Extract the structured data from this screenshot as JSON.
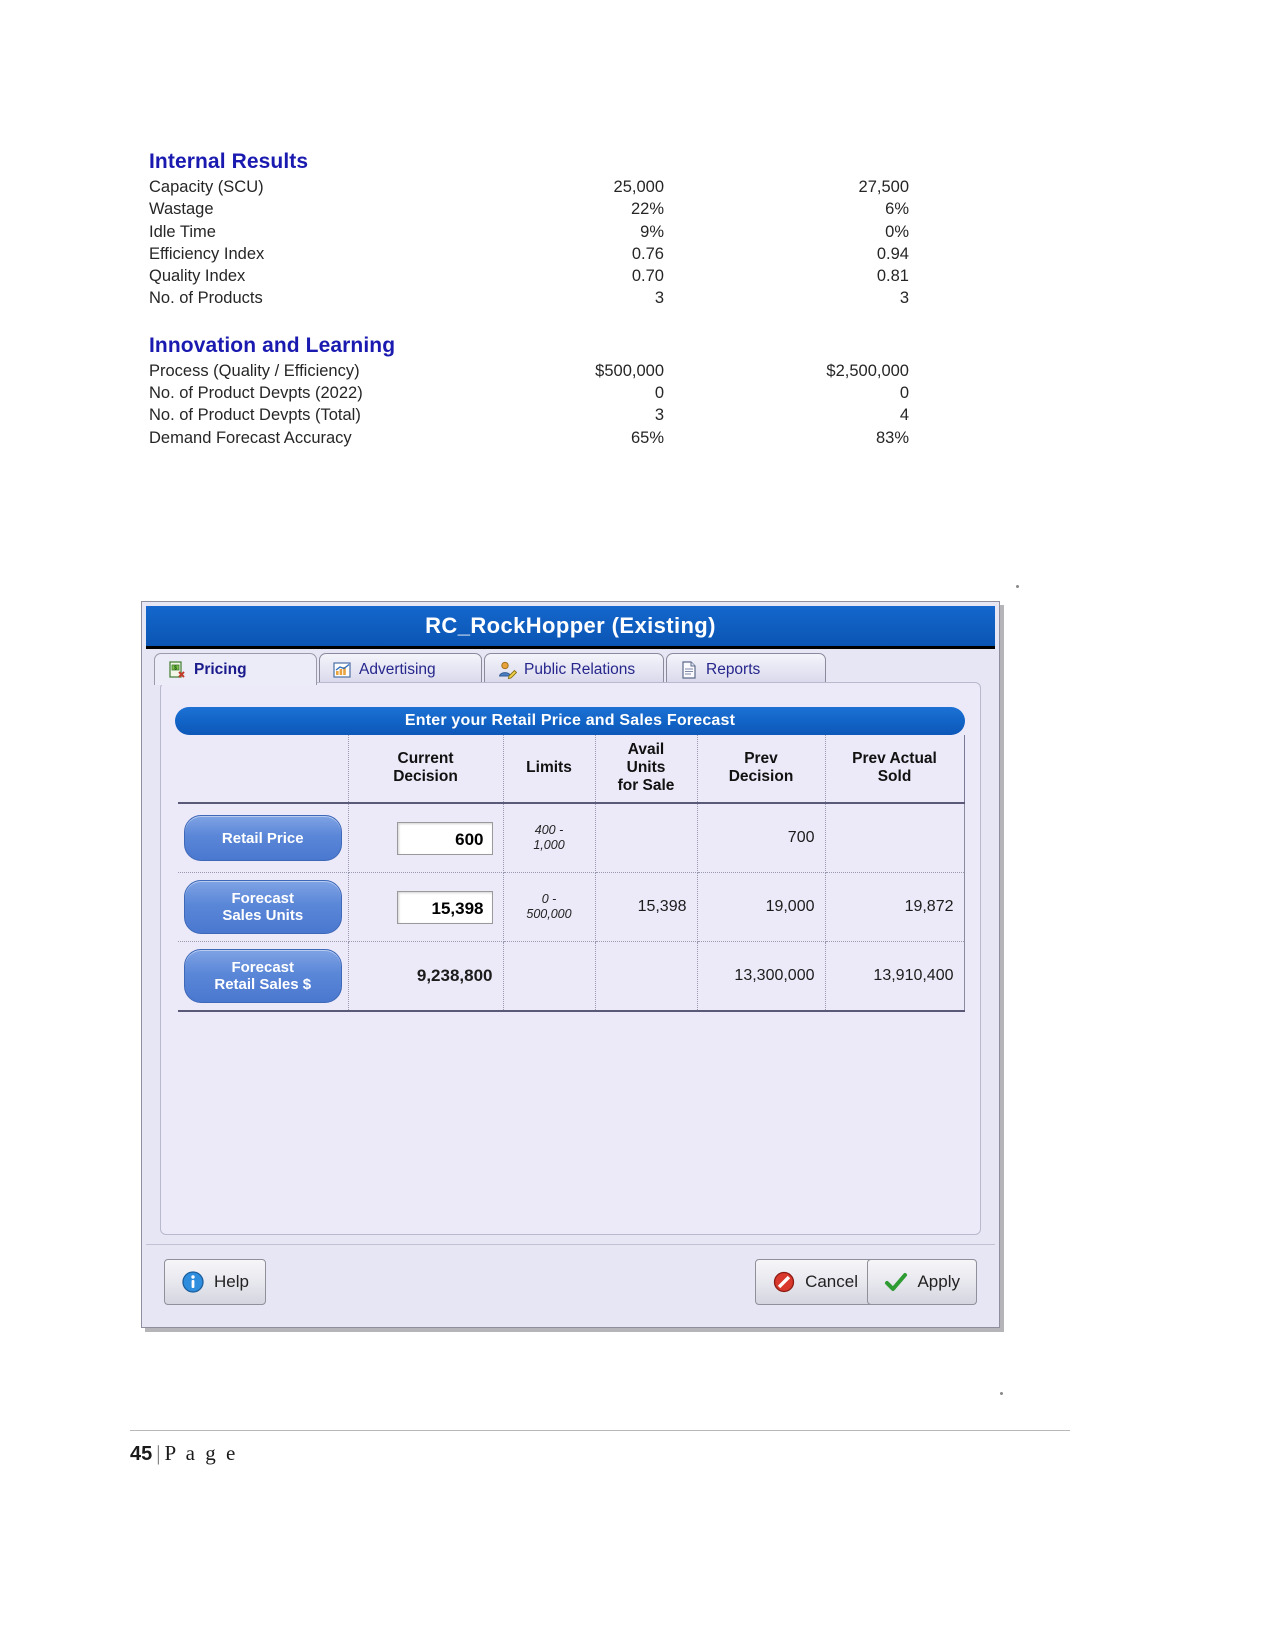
{
  "report": {
    "sections": [
      {
        "title": "Internal Results",
        "rows": [
          {
            "label": "Capacity (SCU)",
            "col1": "25,000",
            "col2": "27,500"
          },
          {
            "label": "Wastage",
            "col1": "22%",
            "col2": "6%"
          },
          {
            "label": "Idle Time",
            "col1": "9%",
            "col2": "0%"
          },
          {
            "label": "Efficiency Index",
            "col1": "0.76",
            "col2": "0.94"
          },
          {
            "label": "Quality Index",
            "col1": "0.70",
            "col2": "0.81"
          },
          {
            "label": "No. of Products",
            "col1": "3",
            "col2": "3"
          }
        ]
      },
      {
        "title": "Innovation and Learning",
        "rows": [
          {
            "label": "Process (Quality / Efficiency)",
            "col1": "$500,000",
            "col2": "$2,500,000"
          },
          {
            "label": "No. of Product Devpts (2022)",
            "col1": "0",
            "col2": "0"
          },
          {
            "label": "No. of Product Devpts (Total)",
            "col1": "3",
            "col2": "4"
          },
          {
            "label": "Demand Forecast Accuracy",
            "col1": "65%",
            "col2": "83%"
          }
        ]
      }
    ]
  },
  "dialog": {
    "title": "RC_RockHopper (Existing)",
    "tabs": [
      {
        "label": "Pricing",
        "icon": "money-document-icon",
        "active": true
      },
      {
        "label": "Advertising",
        "icon": "bar-chart-icon",
        "active": false
      },
      {
        "label": "Public Relations",
        "icon": "person-edit-icon",
        "active": false
      },
      {
        "label": "Reports",
        "icon": "document-icon",
        "active": false
      }
    ],
    "banner": "Enter your Retail Price and Sales Forecast",
    "table": {
      "headers": [
        "",
        "Current Decision",
        "Limits",
        "Avail Units for Sale",
        "Prev Decision",
        "Prev Actual Sold"
      ],
      "headers_multiline": [
        [
          "",
          ""
        ],
        [
          "Current",
          "Decision"
        ],
        [
          "Limits"
        ],
        [
          "Avail",
          "Units",
          "for Sale"
        ],
        [
          "Prev",
          "Decision"
        ],
        [
          "Prev Actual",
          "Sold"
        ]
      ],
      "rows": [
        {
          "label_lines": [
            "Retail Price"
          ],
          "current_decision": "600",
          "editable": true,
          "limits_lines": [
            "400 -",
            "1,000"
          ],
          "avail_units": "",
          "prev_decision": "700",
          "prev_actual_sold": ""
        },
        {
          "label_lines": [
            "Forecast",
            "Sales Units"
          ],
          "current_decision": "15,398",
          "editable": true,
          "limits_lines": [
            "0 -",
            "500,000"
          ],
          "avail_units": "15,398",
          "prev_decision": "19,000",
          "prev_actual_sold": "19,872"
        },
        {
          "label_lines": [
            "Forecast",
            "Retail Sales $"
          ],
          "current_decision": "9,238,800",
          "editable": false,
          "limits_lines": [],
          "avail_units": "",
          "prev_decision": "13,300,000",
          "prev_actual_sold": "13,910,400"
        }
      ]
    },
    "buttons": {
      "help": "Help",
      "cancel": "Cancel",
      "apply": "Apply"
    }
  },
  "page_footer": {
    "number": "45",
    "separator": "|",
    "word": "P a g e"
  }
}
